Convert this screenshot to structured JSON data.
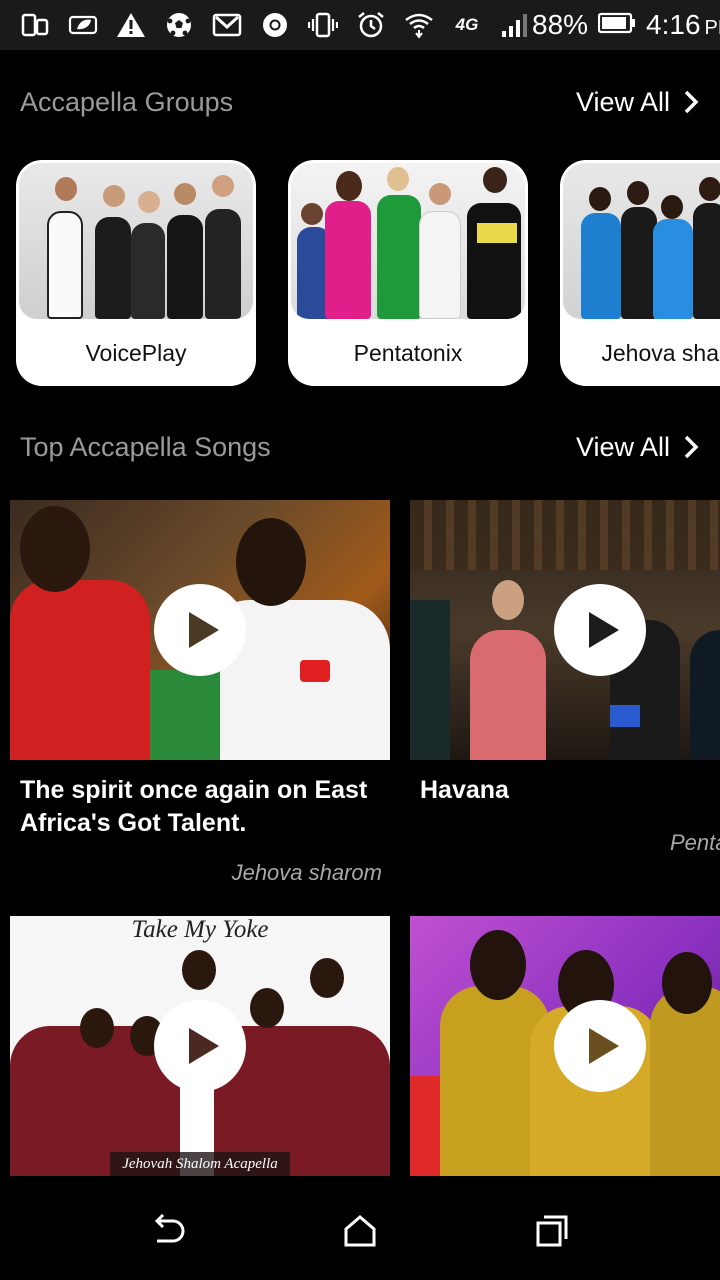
{
  "status_bar": {
    "icons": [
      "screen-rotate-icon",
      "leaf-icon",
      "warning-icon",
      "soccer-ball-icon",
      "gmail-icon",
      "chrome-icon",
      "vibrate-icon",
      "alarm-icon",
      "wifi-icon",
      "lte-icon",
      "signal-icon"
    ],
    "network": "4G",
    "battery": "88%",
    "time": "4:16",
    "ampm": "PM"
  },
  "groups_section": {
    "title": "Accapella Groups",
    "view_all": "View All",
    "items": [
      {
        "name": "VoicePlay"
      },
      {
        "name": "Pentatonix"
      },
      {
        "name": "Jehova sharom"
      }
    ]
  },
  "songs_section": {
    "title": "Top Accapella Songs",
    "view_all": "View All",
    "items": [
      {
        "title": "The spirit once again on East Africa's Got Talent.",
        "artist": "Jehova sharom"
      },
      {
        "title": "Havana",
        "artist": "Pentatonix"
      },
      {
        "title": "",
        "artist": "",
        "thumb_text_top": "Take My Yoke",
        "thumb_text_bottom": "Jehovah Shalom Acapella"
      },
      {
        "title": "",
        "artist": ""
      }
    ]
  },
  "nav_bar": {
    "icons": [
      "back-icon",
      "home-icon",
      "recents-icon"
    ]
  },
  "colors": {
    "background": "#000000",
    "card": "#ffffff",
    "header_gray": "#9a9a9a",
    "artist_gray": "#a8a8a8"
  }
}
